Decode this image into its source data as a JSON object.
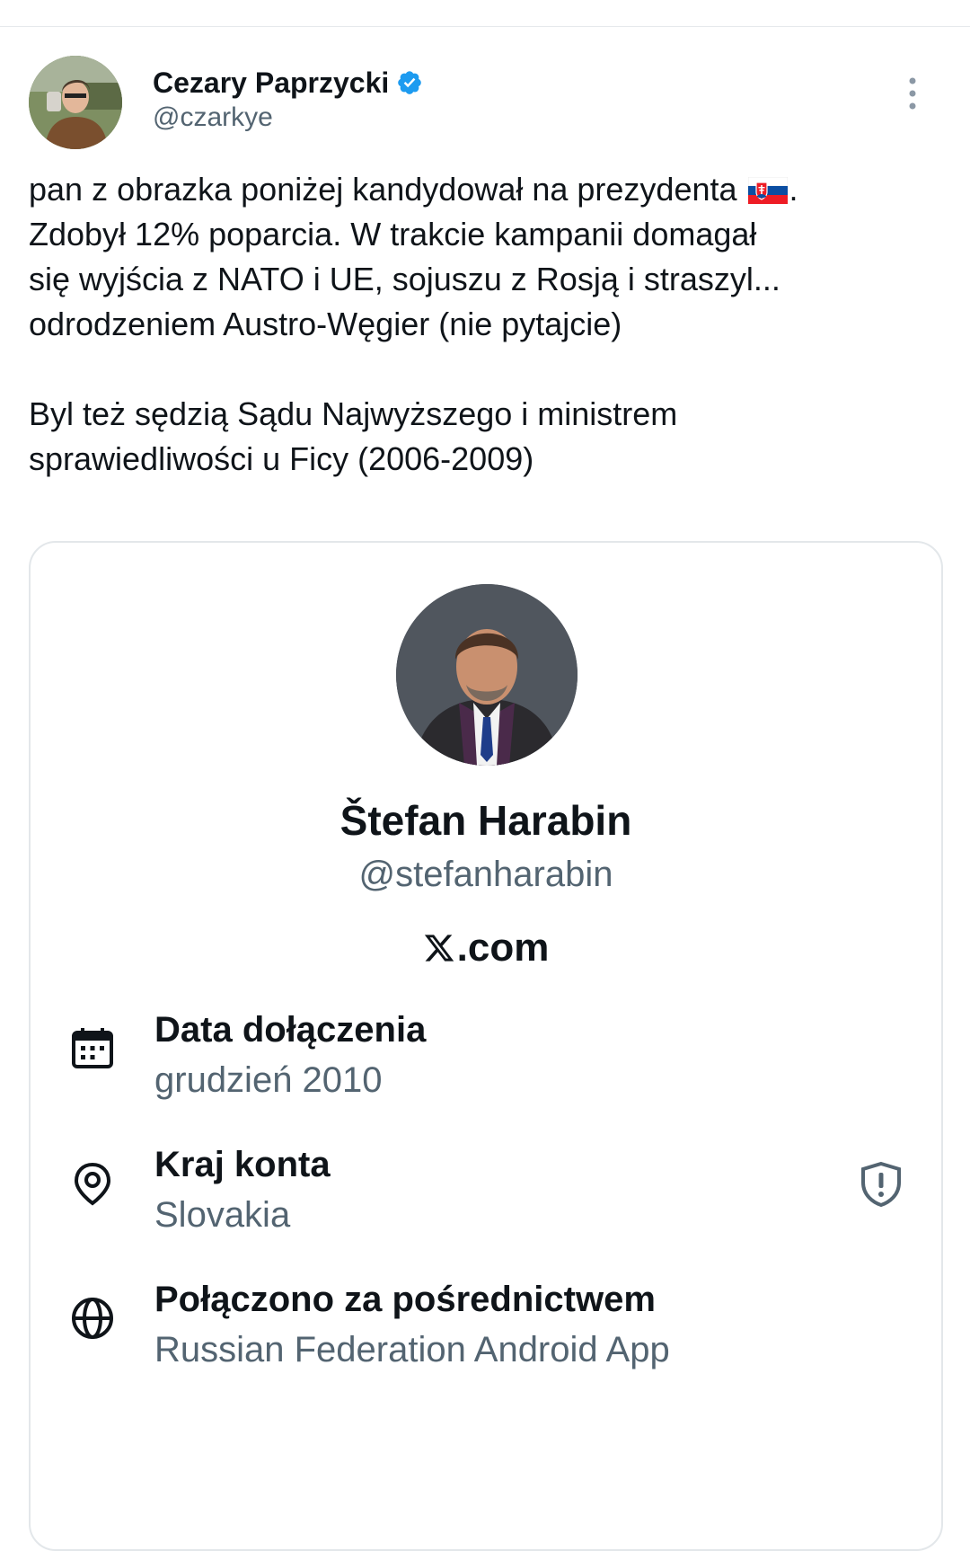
{
  "tweet": {
    "author_name": "Cezary Paprzycki",
    "author_handle": "@czarkye",
    "verified": true,
    "text_part1": "pan z obrazka poniżej kandydował na prezydenta ",
    "flag_icon": "slovakia-flag-icon",
    "text_part2": ".\nZdobył 12% poparcia. W trakcie kampanii domagał\nsię wyjścia z NATO i UE, sojuszu z Rosją i straszyl...\nodrodzeniem Austro-Węgier (nie pytajcie)\n\nByl też sędzią Sądu Najwyższego i ministrem\nsprawiedliwości u Ficy (2006-2009)"
  },
  "card": {
    "name": "Štefan Harabin",
    "handle": "@stefanharabin",
    "domain": ".com",
    "rows": [
      {
        "label": "Data dołączenia",
        "value": "grudzień 2010",
        "icon": "calendar-icon"
      },
      {
        "label": "Kraj konta",
        "value": "Slovakia",
        "icon": "location-pin-icon"
      },
      {
        "label": "Połączono za pośrednictwem",
        "value": "Russian Federation Android App",
        "icon": "globe-icon"
      }
    ]
  },
  "colors": {
    "text_primary": "#0f1419",
    "text_secondary": "#536471",
    "verified_blue": "#1d9bf0",
    "border": "#e3e7ea"
  }
}
